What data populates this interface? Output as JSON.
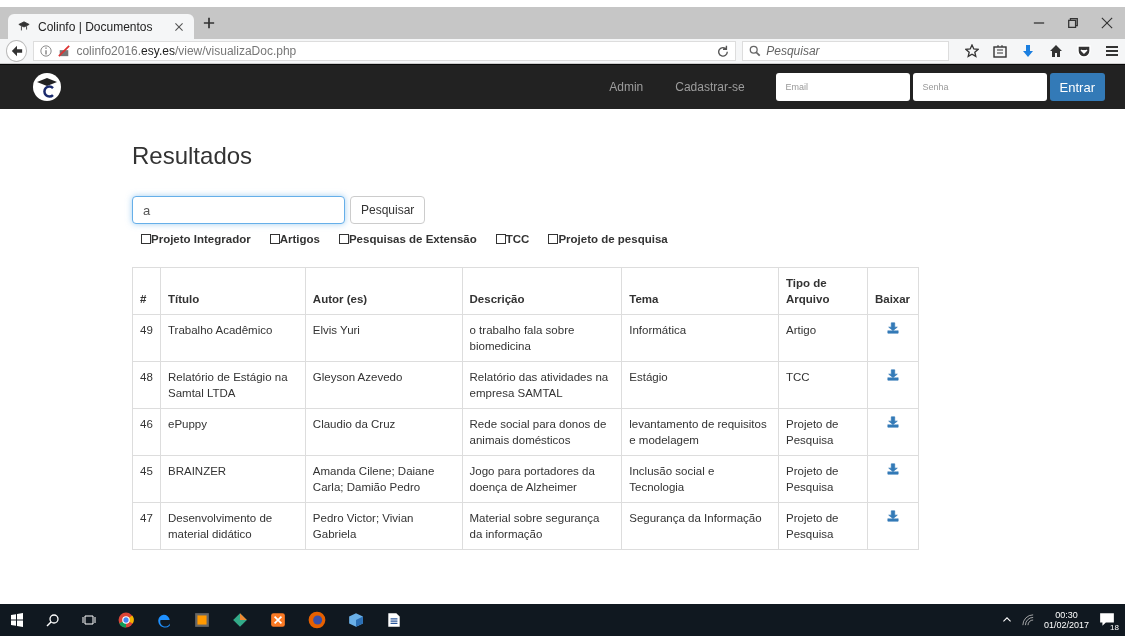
{
  "browser": {
    "tab": {
      "title": "Colinfo | Documentos",
      "selected": true
    },
    "url": "colinfo2016.**esy.es**/view/visualizaDoc.php",
    "search": {
      "placeholder": "Pesquisar"
    }
  },
  "navbar": {
    "links": [
      "Admin",
      "Cadastrar-se"
    ],
    "email": {
      "placeholder": "Email"
    },
    "password": {
      "placeholder": "Senha"
    },
    "submit": "Entrar"
  },
  "heading": "Resultados",
  "search": {
    "value": "a",
    "button": "Pesquisar"
  },
  "filters": [
    {
      "label": "Projeto Integrador",
      "checked": false
    },
    {
      "label": "Artigos",
      "checked": false
    },
    {
      "label": "Pesquisas de Extensão",
      "checked": false
    },
    {
      "label": "TCC",
      "checked": false
    },
    {
      "label": "Projeto de pesquisa",
      "checked": false
    }
  ],
  "table": {
    "columns": [
      "#",
      "Título",
      "Autor (es)",
      "Descrição",
      "Tema",
      "Tipo de Arquivo",
      "Baixar"
    ],
    "rows": [
      {
        "id": "49",
        "title": "Trabalho Acadêmico",
        "author": "Elvis Yuri",
        "description": "o trabalho fala sobre biomedicina",
        "theme": "Informática",
        "type": "Artigo"
      },
      {
        "id": "48",
        "title": "Relatório de Estágio na Samtal LTDA",
        "author": "Gleyson Azevedo",
        "description": "Relatório das atividades na empresa SAMTAL",
        "theme": "Estágio",
        "type": "TCC"
      },
      {
        "id": "46",
        "title": "ePuppy",
        "author": "Claudio da Cruz",
        "description": "Rede social para donos de animais domésticos",
        "theme": "levantamento de requisitos e modelagem",
        "type": "Projeto de Pesquisa"
      },
      {
        "id": "45",
        "title": "BRAINZER",
        "author": "Amanda Cilene; Daiane Carla; Damião Pedro",
        "description": "Jogo para portadores da doença de Alzheimer",
        "theme": "Inclusão social e Tecnologia",
        "type": "Projeto de Pesquisa"
      },
      {
        "id": "47",
        "title": "Desenvolvimento de material didático",
        "author": "Pedro Victor; Vivian Gabriela",
        "description": "Material sobre segurança da informação",
        "theme": "Segurança da Informação",
        "type": "Projeto de Pesquisa"
      }
    ]
  },
  "taskbar": {
    "time": "00:30",
    "date": "01/02/2017",
    "notifications": "18"
  }
}
